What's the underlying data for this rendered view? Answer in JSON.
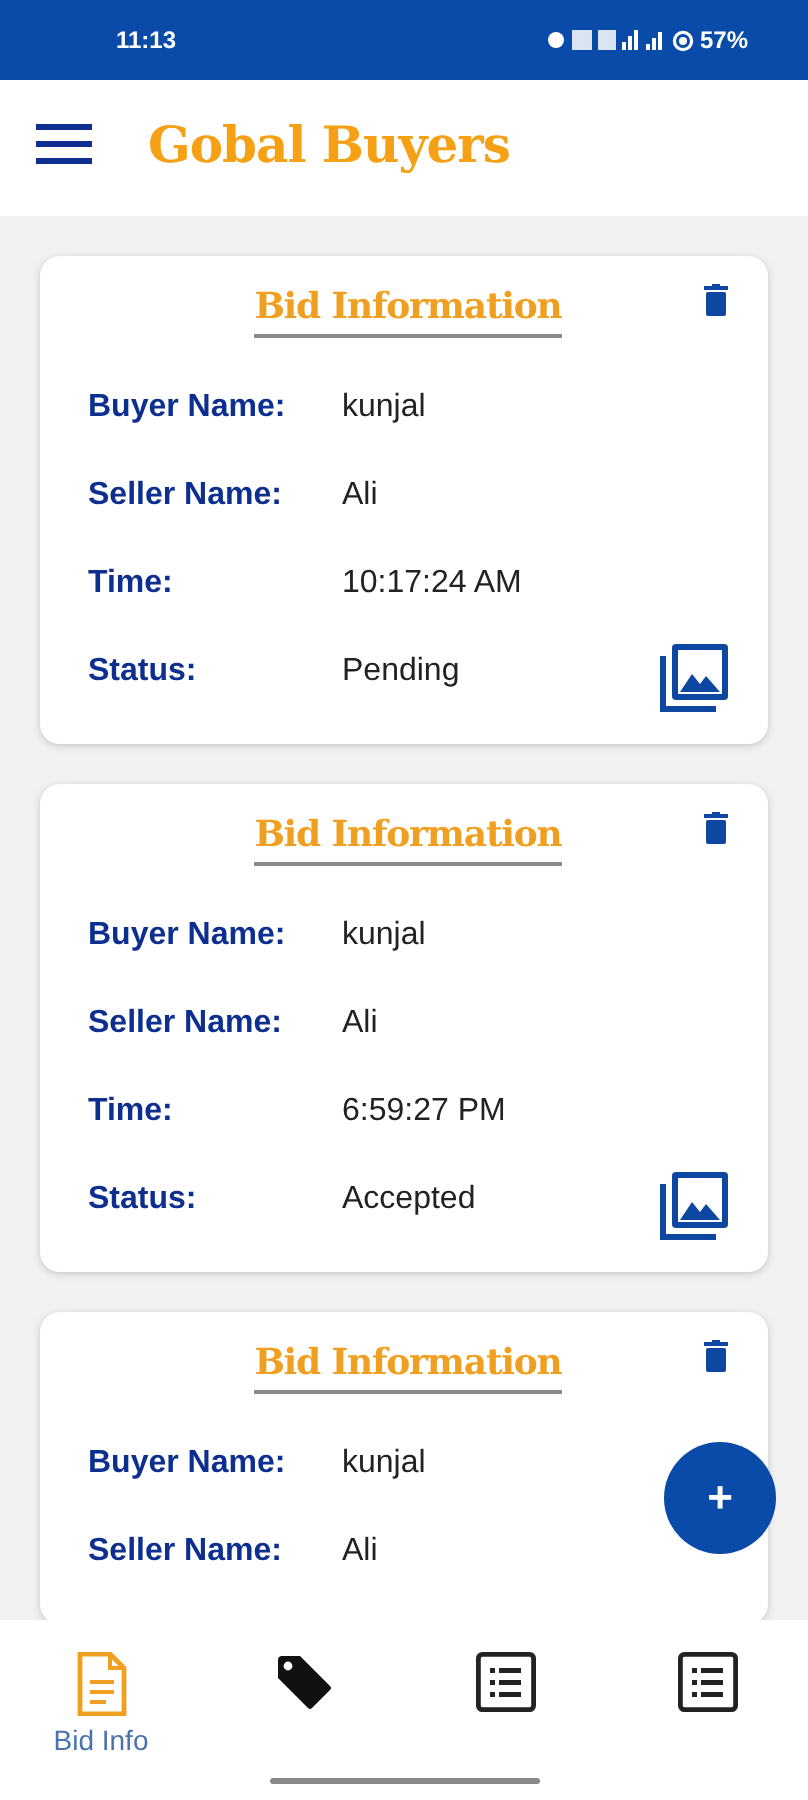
{
  "status_bar": {
    "time": "11:13",
    "battery": "57%"
  },
  "app_bar": {
    "title": "Gobal Buyers"
  },
  "cards": [
    {
      "title": "Bid Information",
      "fields": [
        {
          "label": "Buyer Name:",
          "value": "kunjal"
        },
        {
          "label": "Seller Name:",
          "value": "Ali"
        },
        {
          "label": "Time:",
          "value": "10:17:24 AM"
        },
        {
          "label": "Status:",
          "value": "Pending"
        }
      ]
    },
    {
      "title": "Bid Information",
      "fields": [
        {
          "label": "Buyer Name:",
          "value": "kunjal"
        },
        {
          "label": "Seller Name:",
          "value": "Ali"
        },
        {
          "label": "Time:",
          "value": "6:59:27 PM"
        },
        {
          "label": "Status:",
          "value": "Accepted"
        }
      ]
    },
    {
      "title": "Bid Information",
      "fields": [
        {
          "label": "Buyer Name:",
          "value": "kunjal"
        },
        {
          "label": "Seller Name:",
          "value": "Ali"
        }
      ]
    }
  ],
  "fab": {
    "label": "+"
  },
  "bottom_nav": [
    {
      "label": "Bid Info",
      "selected": true
    },
    {
      "selected": false
    },
    {
      "selected": false
    },
    {
      "selected": false
    }
  ]
}
